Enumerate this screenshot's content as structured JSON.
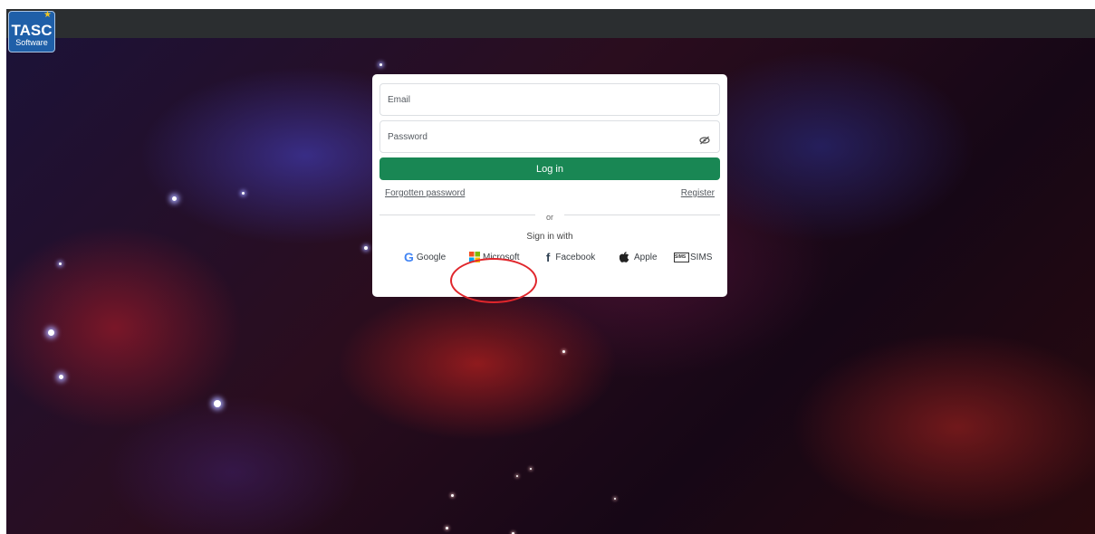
{
  "brand": {
    "title": "TASC",
    "subtitle": "Software"
  },
  "login": {
    "email_placeholder": "Email",
    "password_placeholder": "Password",
    "login_label": "Log in",
    "forgot_label": "Forgotten password",
    "register_label": "Register",
    "or_label": "or",
    "signin_label": "Sign in with"
  },
  "providers": {
    "google": "Google",
    "microsoft": "Microsoft",
    "facebook": "Facebook",
    "apple": "Apple",
    "sims": "SIMS",
    "sims_icon_text": "SIMS"
  },
  "colors": {
    "primary_button": "#198754",
    "highlight": "#e0262c",
    "topbar": "#2b2e30"
  }
}
